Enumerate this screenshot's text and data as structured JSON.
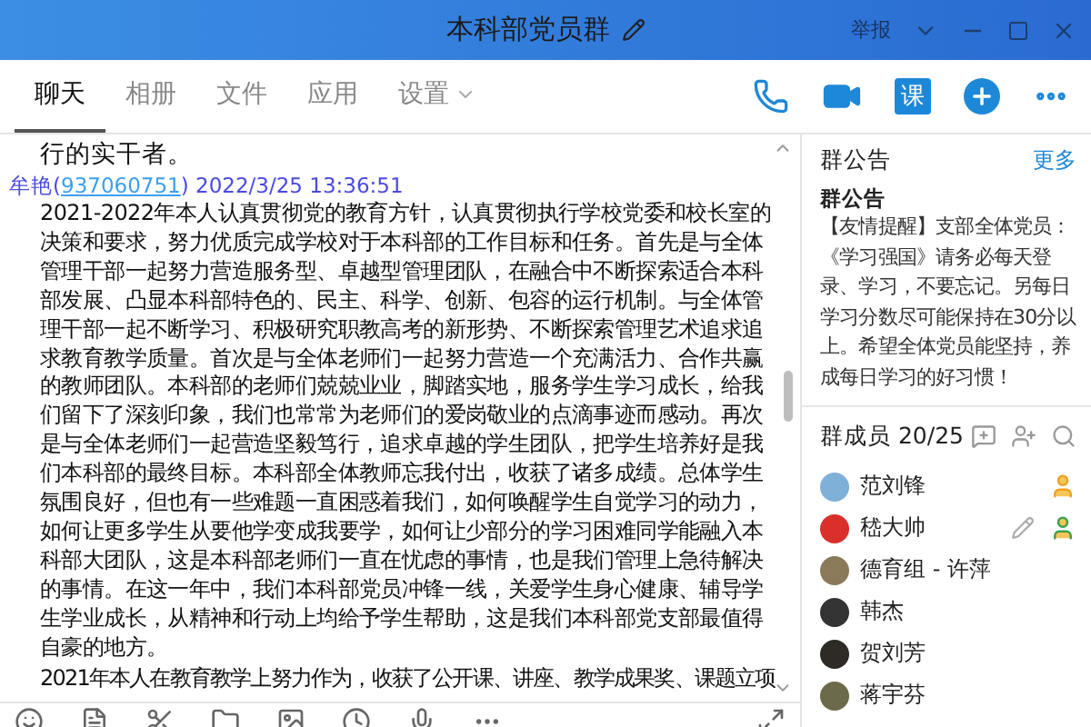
{
  "window": {
    "title": "本科部党员群",
    "report": "举报"
  },
  "tabs": [
    {
      "label": "聊天",
      "selected": true,
      "dropdown": false
    },
    {
      "label": "相册",
      "selected": false,
      "dropdown": false
    },
    {
      "label": "文件",
      "selected": false,
      "dropdown": false
    },
    {
      "label": "应用",
      "selected": false,
      "dropdown": false
    },
    {
      "label": "设置",
      "selected": false,
      "dropdown": true
    }
  ],
  "toolbar": {
    "lesson_button": "课"
  },
  "chat": {
    "previous_tail": "行的实干者。",
    "message": {
      "sender": "牟艳(",
      "sender_id": "937060751",
      "meta": ") 2022/3/25 13:36:51",
      "paragraphs": [
        "2021-2022年本人认真贯彻党的教育方针，认真贯彻执行学校党委和校长室的决策和要求，努力优质完成学校对于本科部的工作目标和任务。首先是与全体管理干部一起努力营造服务型、卓越型管理团队，在融合中不断探索适合本科部发展、凸显本科部特色的、民主、科学、创新、包容的运行机制。与全体管理干部一起不断学习、积极研究职教高考的新形势、不断探索管理艺术追求追求教育教学质量。首次是与全体老师们一起努力营造一个充满活力、合作共赢的教师团队。本科部的老师们兢兢业业，脚踏实地，服务学生学习成长，给我们留下了深刻印象，我们也常常为老师们的爱岗敬业的点滴事迹而感动。再次是与全体老师们一起营造坚毅笃行，追求卓越的学生团队，把学生培养好是我们本科部的最终目标。本科部全体教师忘我付出，收获了诸多成绩。总体学生氛围良好，但也有一些难题一直困惑着我们，如何唤醒学生自觉学习的动力，如何让更多学生从要他学变成我要学，如何让少部分的学习困难同学能融入本科部大团队，这是本科部老师们一直在忧虑的事情，也是我们管理上急待解决的事情。在这一年中，我们本科部党员冲锋一线，关爱学生身心健康、辅导学生学业成长，从精神和行动上均给予学生帮助，这是我们本科部党支部最值得自豪的地方。",
        "2021年本人在教育教学上努力作为，收获了公开课、讲座、教学成果奖、课题立项"
      ]
    }
  },
  "notice": {
    "heading": "群公告",
    "more": "更多",
    "title": "群公告",
    "text": "【友情提醒】支部全体党员：《学习强国》请务必每天登录、学习，不要忘记。另每日学习分数尽可能保持在30分以上。希望全体党员能坚持，养成每日学习的好习惯！"
  },
  "members": {
    "heading": "群成员 20/25",
    "list": [
      {
        "name": "范刘锋",
        "kind": "owner",
        "color": "#7fb0d8"
      },
      {
        "name": "嵇大帅",
        "kind": "admin",
        "color": "#d9302c"
      },
      {
        "name": "德育组 - 许萍",
        "kind": "member",
        "color": "#8a7a5a"
      },
      {
        "name": "韩杰",
        "kind": "member",
        "color": "#333333"
      },
      {
        "name": "贺刘芳",
        "kind": "member",
        "color": "#2e2a26"
      },
      {
        "name": "蒋宇芬",
        "kind": "member",
        "color": "#6b6a4a"
      }
    ]
  }
}
